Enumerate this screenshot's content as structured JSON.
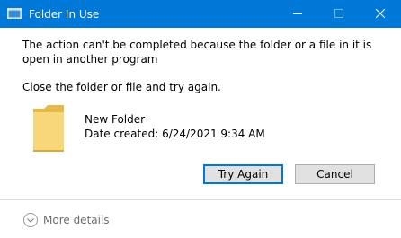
{
  "window": {
    "title": "Folder In Use",
    "accent_color": "#0078d7"
  },
  "message": {
    "main": "The action can't be completed because the folder or a file in it is open in another program",
    "sub": "Close the folder or file and try again."
  },
  "item": {
    "icon": "folder-icon",
    "name": "New Folder",
    "date_created": "Date created: 6/24/2021 9:34 AM"
  },
  "buttons": {
    "try_again": "Try Again",
    "cancel": "Cancel"
  },
  "details": {
    "label": "More details",
    "icon": "chevron-down-icon"
  }
}
